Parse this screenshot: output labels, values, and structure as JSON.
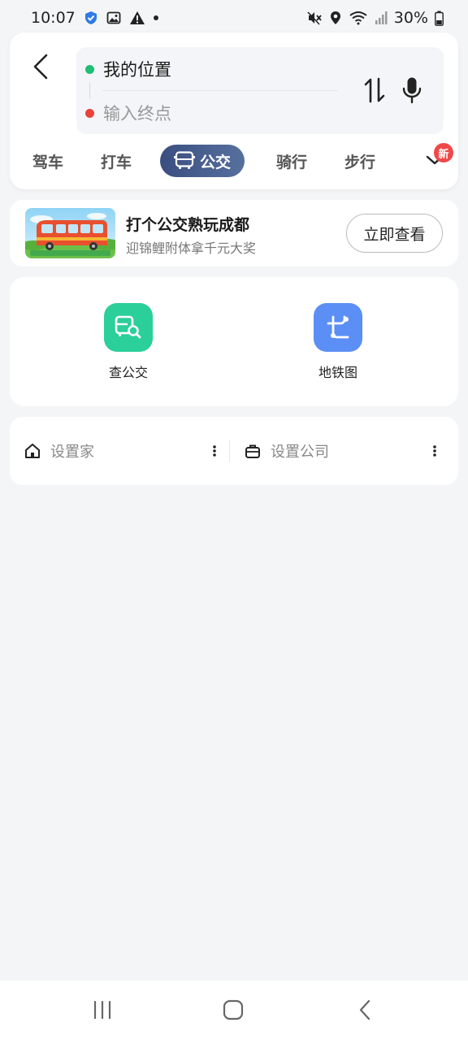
{
  "status": {
    "time": "10:07",
    "battery": "30%"
  },
  "route": {
    "start_label": "我的位置",
    "end_placeholder": "输入终点",
    "start_dot_color": "#1dbf73",
    "end_dot_color": "#e8423a"
  },
  "modes": [
    {
      "label": "驾车"
    },
    {
      "label": "打车"
    },
    {
      "label": "公交"
    },
    {
      "label": "骑行"
    },
    {
      "label": "步行"
    }
  ],
  "modes_active_index": 2,
  "new_badge": "新",
  "promo": {
    "title": "打个公交熟玩成都",
    "subtitle": "迎锦鲤附体拿千元大奖",
    "button": "立即查看"
  },
  "tools": [
    {
      "label": "查公交",
      "icon": "bus-search-icon",
      "color": "#2bcf9a"
    },
    {
      "label": "地铁图",
      "icon": "subway-map-icon",
      "color": "#5b8ff5"
    }
  ],
  "places": {
    "home": "设置家",
    "work": "设置公司"
  }
}
